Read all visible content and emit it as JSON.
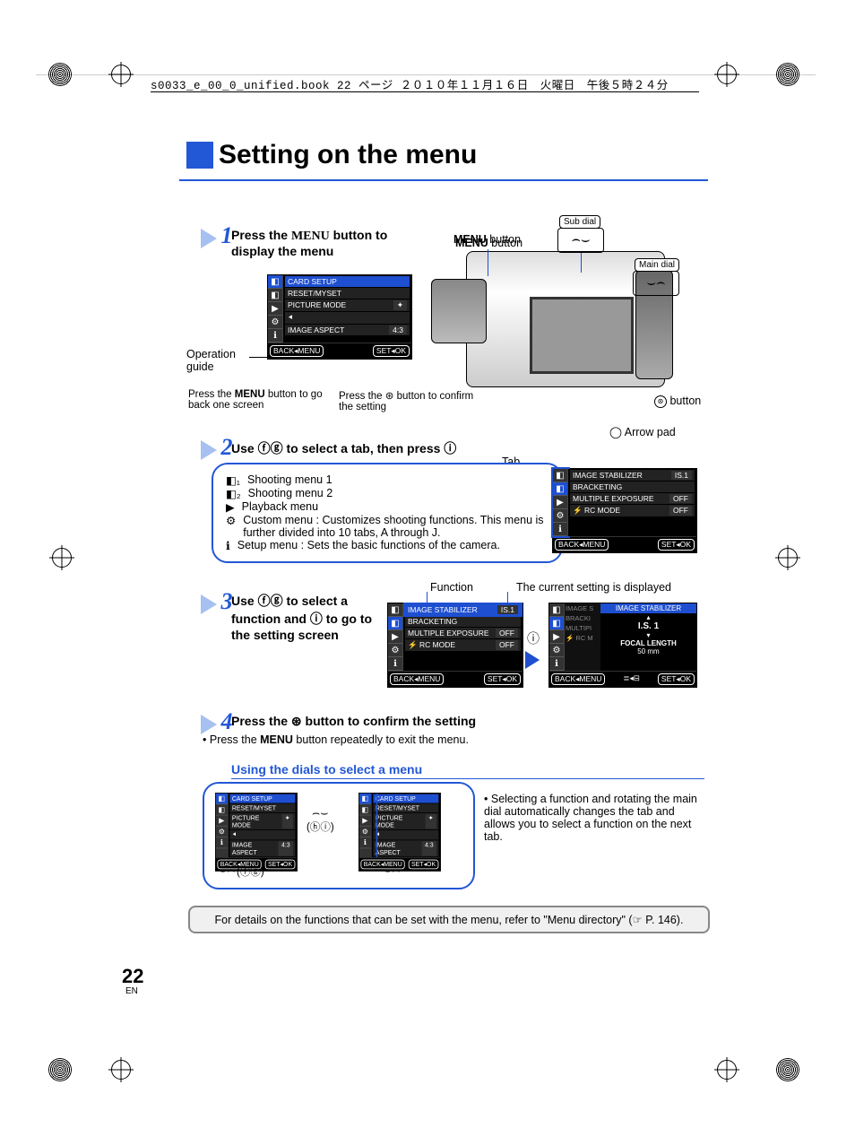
{
  "meta": {
    "header_line": "s0033_e_00_0_unified.book  22 ページ  ２０１０年１１月１６日　火曜日　午後５時２４分",
    "page_number": "22",
    "page_lang": "EN"
  },
  "title": "Setting on the menu",
  "step1": {
    "num": "1",
    "heading_a": "Press the ",
    "heading_b": "MENU",
    "heading_c": " button to display the menu",
    "op_guide": "Operation guide",
    "note_a_1": "Press the ",
    "note_a_2": "MENU",
    "note_a_3": " button to go back one screen",
    "note_b": "Press the ⊛ button to confirm the setting",
    "callout_menu": "MENU button",
    "callout_sub_dial": "Sub dial",
    "callout_main_dial": "Main dial",
    "callout_ok_btn": "⊛ button",
    "callout_arrow_pad": "Arrow pad",
    "lcd": {
      "items": [
        {
          "label": "CARD SETUP",
          "val": ""
        },
        {
          "label": "RESET/MYSET",
          "val": ""
        },
        {
          "label": "PICTURE MODE",
          "val": "✦"
        },
        {
          "label": "⯇",
          "val": ""
        },
        {
          "label": "IMAGE ASPECT",
          "val": "4:3"
        }
      ],
      "back": "BACK◂MENU",
      "set": "SET◂OK"
    }
  },
  "step2": {
    "num": "2",
    "heading": "Use ⓕⓖ to select a tab, then press ⓘ",
    "tab_label": "Tab",
    "list": [
      "Shooting menu 1",
      "Shooting menu 2",
      "Playback menu",
      "Custom menu : Customizes shooting functions. This menu is further divided into 10 tabs, A through J.",
      "Setup menu : Sets the basic functions of the camera."
    ],
    "lcd": {
      "items": [
        {
          "label": "IMAGE STABILIZER",
          "val": "IS.1"
        },
        {
          "label": "BRACKETING",
          "val": ""
        },
        {
          "label": "MULTIPLE EXPOSURE",
          "val": "OFF"
        },
        {
          "label": "⚡ RC MODE",
          "val": "OFF"
        }
      ],
      "back": "BACK◂MENU",
      "set": "SET◂OK"
    }
  },
  "step3": {
    "num": "3",
    "heading": "Use ⓕⓖ to select a function and ⓘ to go to the setting screen",
    "callout_func": "Function",
    "callout_curr": "The current setting is displayed",
    "lcd_a": {
      "items": [
        {
          "label": "IMAGE STABILIZER",
          "val": "IS.1",
          "hl": true
        },
        {
          "label": "BRACKETING",
          "val": ""
        },
        {
          "label": "MULTIPLE EXPOSURE",
          "val": "OFF"
        },
        {
          "label": "⚡ RC MODE",
          "val": "OFF"
        }
      ],
      "back": "BACK◂MENU",
      "set": "SET◂OK"
    },
    "lcd_b": {
      "title": "IMAGE  STABILIZER",
      "value": "I.S. 1",
      "focal_label": "FOCAL LENGTH",
      "focal_val": "50 mm",
      "back": "BACK◂MENU",
      "mid": "≣◂⊟",
      "set": "SET◂OK",
      "side": [
        "IMAGE S",
        "BRACKI",
        "MULTIPI",
        "⚡ RC M"
      ]
    }
  },
  "step4": {
    "num": "4",
    "heading": "Press the ⊛ button to confirm the setting",
    "bullet_a": "Press the ",
    "bullet_b": "MENU",
    "bullet_c": " button repeatedly to exit the menu."
  },
  "dials": {
    "heading": "Using the dials to select a menu",
    "bullet": "Selecting a function and rotating the main dial automatically changes the tab and allows you to select a function on the next tab.",
    "lcd": {
      "items": [
        {
          "label": "CARD SETUP",
          "val": ""
        },
        {
          "label": "RESET/MYSET",
          "val": ""
        },
        {
          "label": "PICTURE MODE",
          "val": "✦"
        },
        {
          "label": "⯇",
          "val": ""
        },
        {
          "label": "IMAGE ASPECT",
          "val": "4:3"
        }
      ],
      "back": "BACK◂MENU",
      "set": "SET◂OK"
    },
    "sym_a": "(ⓗⓘ)",
    "sym_b": "(ⓕⓖ)"
  },
  "footer_note": "For details on the functions that can be set with the menu, refer to \"Menu directory\" (☞ P. 146)."
}
